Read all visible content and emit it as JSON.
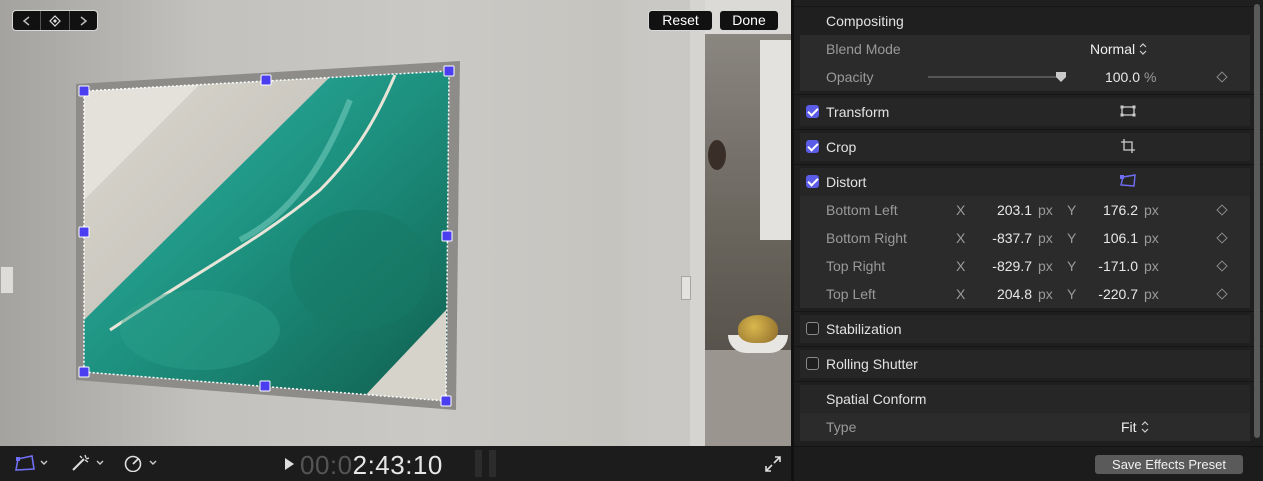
{
  "viewer": {
    "reset_label": "Reset",
    "done_label": "Done",
    "timecode_dim": "00:0",
    "timecode_bright": "2:43:10"
  },
  "inspector": {
    "compositing": {
      "title": "Compositing",
      "blend_mode_label": "Blend Mode",
      "blend_mode_value": "Normal",
      "opacity_label": "Opacity",
      "opacity_value": "100.0",
      "opacity_unit": "%",
      "opacity_level": 1.0
    },
    "transform": {
      "label": "Transform",
      "checked": true
    },
    "crop": {
      "label": "Crop",
      "checked": true
    },
    "distort": {
      "label": "Distort",
      "checked": true,
      "x_axis": "X",
      "y_axis": "Y",
      "unit": "px",
      "params": [
        {
          "label": "Bottom Left",
          "x": "203.1",
          "y": "176.2"
        },
        {
          "label": "Bottom Right",
          "x": "-837.7",
          "y": "106.1"
        },
        {
          "label": "Top Right",
          "x": "-829.7",
          "y": "-171.0"
        },
        {
          "label": "Top Left",
          "x": "204.8",
          "y": "-220.7"
        }
      ]
    },
    "stabilization": {
      "label": "Stabilization",
      "checked": false
    },
    "rolling_shutter": {
      "label": "Rolling Shutter",
      "checked": false
    },
    "spatial_conform": {
      "title": "Spatial Conform",
      "type_label": "Type",
      "type_value": "Fit"
    },
    "save_preset_label": "Save Effects Preset"
  },
  "colors": {
    "accent": "#5b5ce8",
    "handle": "#4b3df0"
  }
}
